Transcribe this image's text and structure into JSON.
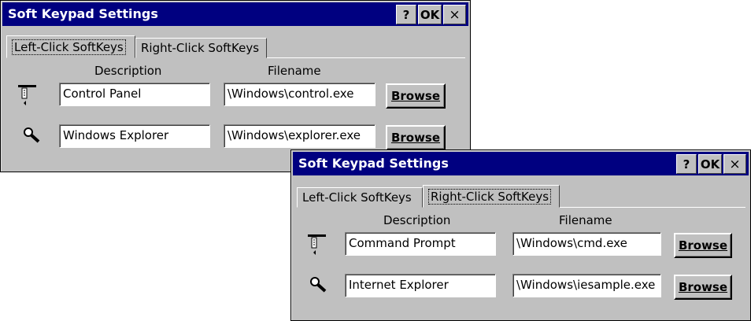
{
  "dialogs": [
    {
      "title": "Soft Keypad Settings",
      "help_label": "?",
      "ok_label": "OK",
      "close_label": "×",
      "tabs": [
        "Left-Click SoftKeys",
        "Right-Click SoftKeys"
      ],
      "active_tab": "Left-Click SoftKeys",
      "col_description": "Description",
      "col_filename": "Filename",
      "rows": [
        {
          "icon": "control-panel-icon",
          "description": "Control Panel",
          "filename": "\\Windows\\control.exe",
          "browse_label": "Browse"
        },
        {
          "icon": "magnifier-icon",
          "description": "Windows Explorer",
          "filename": "\\Windows\\explorer.exe",
          "browse_label": "Browse"
        }
      ]
    },
    {
      "title": "Soft Keypad Settings",
      "help_label": "?",
      "ok_label": "OK",
      "close_label": "×",
      "tabs": [
        "Left-Click SoftKeys",
        "Right-Click SoftKeys"
      ],
      "active_tab": "Right-Click SoftKeys",
      "col_description": "Description",
      "col_filename": "Filename",
      "rows": [
        {
          "icon": "control-panel-icon",
          "description": "Command Prompt",
          "filename": "\\Windows\\cmd.exe",
          "browse_label": "Browse"
        },
        {
          "icon": "magnifier-icon",
          "description": "Internet Explorer",
          "filename": "\\Windows\\iesample.exe",
          "browse_label": "Browse"
        }
      ]
    }
  ]
}
